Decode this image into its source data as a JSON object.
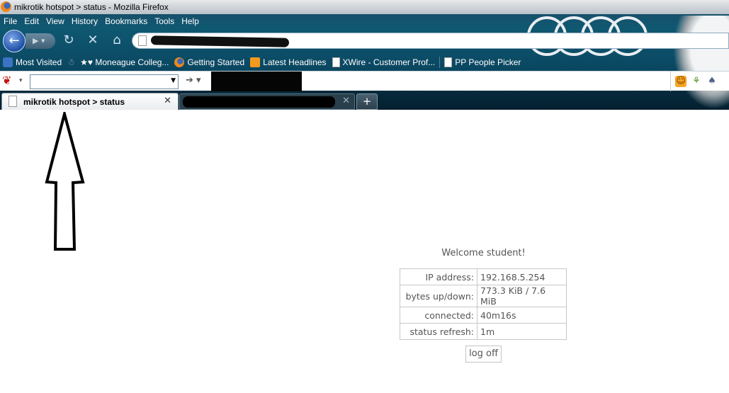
{
  "window": {
    "title": "mikrotik hotspot > status - Mozilla Firefox"
  },
  "menu": [
    "File",
    "Edit",
    "View",
    "History",
    "Bookmarks",
    "Tools",
    "Help"
  ],
  "navigation": {
    "back_icon": "back-arrow-icon",
    "forward_icon": "forward-arrow-icon",
    "reload_icon": "reload-icon",
    "stop_icon": "stop-icon",
    "home_icon": "home-icon",
    "url_value": ""
  },
  "bookmarks": [
    {
      "label": "Most Visited",
      "icon": "most-visited-icon"
    },
    {
      "label": "★♥ Moneague Colleg...",
      "icon": "devil-icon"
    },
    {
      "label": "Getting Started",
      "icon": "firefox-icon"
    },
    {
      "label": "Latest Headlines",
      "icon": "rss-icon"
    },
    {
      "label": "XWire - Customer Prof...",
      "icon": "page-icon"
    },
    {
      "label": "PP People Picker",
      "icon": "page-icon"
    }
  ],
  "search_toolbar": {
    "value": ""
  },
  "tabs": {
    "active": {
      "label": "mikrotik hotspot > status"
    },
    "new_tab_label": "+"
  },
  "status_page": {
    "welcome": "Welcome student!",
    "rows": [
      {
        "key": "IP address:",
        "value": "192.168.5.254"
      },
      {
        "key": "bytes up/down:",
        "value": "773.3 KiB / 7.6 MiB"
      },
      {
        "key": "connected:",
        "value": "40m16s"
      },
      {
        "key": "status refresh:",
        "value": "1m"
      }
    ],
    "logoff_label": "log off"
  }
}
